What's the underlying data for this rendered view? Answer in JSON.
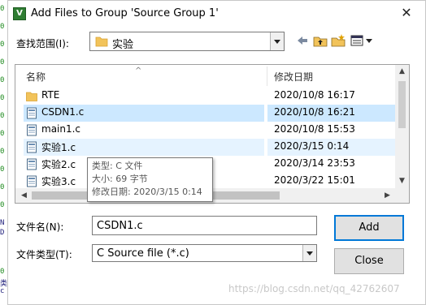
{
  "window": {
    "title": "Add Files to Group 'Source Group 1'",
    "icon_letter": "V"
  },
  "look_in": {
    "label": "查找范围(I):",
    "value": "实验"
  },
  "columns": {
    "name": "名称",
    "date": "修改日期"
  },
  "files": [
    {
      "name": "RTE",
      "date": "2020/10/8 16:17",
      "kind": "folder",
      "state": ""
    },
    {
      "name": "CSDN1.c",
      "date": "2020/10/8 16:21",
      "kind": "c-file",
      "state": "selected"
    },
    {
      "name": "main1.c",
      "date": "2020/10/8 15:53",
      "kind": "c-file",
      "state": ""
    },
    {
      "name": "实验1.c",
      "date": "2020/3/15 0:14",
      "kind": "c-file",
      "state": "hover"
    },
    {
      "name": "实验2.c",
      "date": "2020/3/14 23:53",
      "kind": "c-file",
      "state": ""
    },
    {
      "name": "实验3.c",
      "date": "2020/3/22 15:01",
      "kind": "c-file",
      "state": ""
    }
  ],
  "tooltip": {
    "type_line": "类型: C 文件",
    "size_line": "大小: 69 字节",
    "date_line": "修改日期: 2020/3/15 0:14"
  },
  "file_name": {
    "label": "文件名(N):",
    "value": "CSDN1.c"
  },
  "file_type": {
    "label": "文件类型(T):",
    "value": "C Source file (*.c)"
  },
  "buttons": {
    "add": "Add",
    "close": "Close"
  },
  "watermark": "https://blog.csdn.net/qq_42762607",
  "colors": {
    "selection": "#cce8ff",
    "hover": "#e5f3ff",
    "default_button_border": "#0078d7",
    "folder": "#f2c35a"
  }
}
